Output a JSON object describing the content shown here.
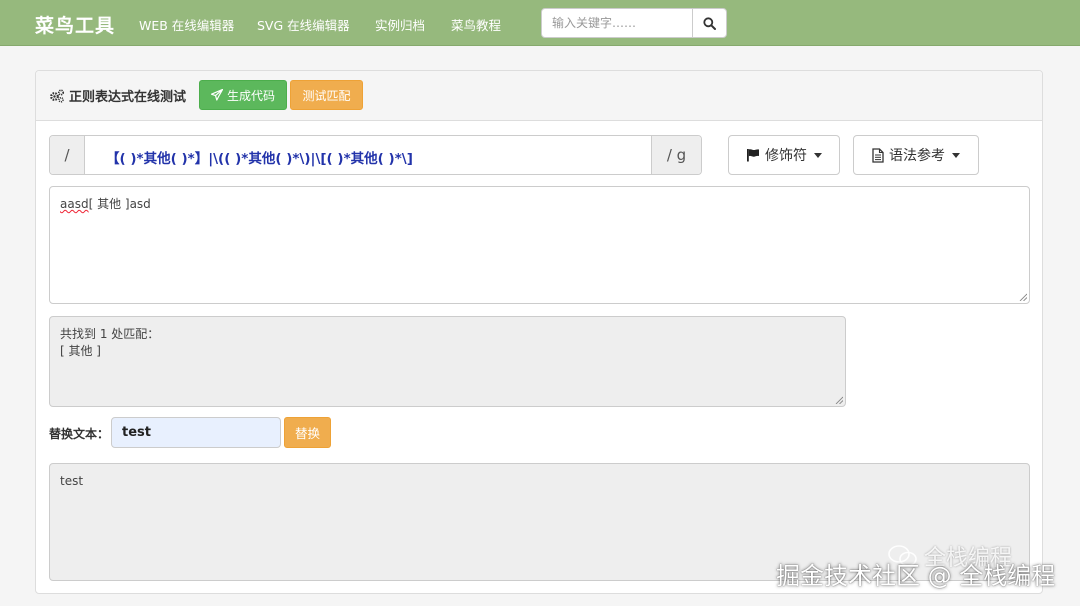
{
  "navbar": {
    "brand": "菜鸟工具",
    "links": [
      "WEB 在线编辑器",
      "SVG 在线编辑器",
      "实例归档",
      "菜鸟教程"
    ],
    "search_placeholder": "输入关键字……"
  },
  "panel": {
    "title": "正则表达式在线测试",
    "generate_code_label": "生成代码",
    "test_match_label": "测试匹配"
  },
  "regex": {
    "open_delimiter": "/",
    "pattern": "【( )*其他( )*】|\\(( )*其他( )*\\)|\\[( )*其他( )*\\]",
    "flags": "/ g",
    "modifier_label": "修饰符",
    "syntax_ref_label": "语法参考"
  },
  "input_text": {
    "misspelled": "aasd",
    "rest": "[ 其他 ]asd"
  },
  "result": {
    "line1": "共找到 1 处匹配：",
    "line2": "[ 其他 ]"
  },
  "replace": {
    "label": "替换文本：",
    "value": "test",
    "button_label": "替换",
    "output": "test"
  },
  "watermark": {
    "text": "掘金技术社区 @ 全栈编程",
    "text2": "全栈编程"
  },
  "colors": {
    "navbar": "#96b97d",
    "success": "#5cb85c",
    "warning": "#f0ad4e",
    "regex_text": "#2233aa"
  }
}
